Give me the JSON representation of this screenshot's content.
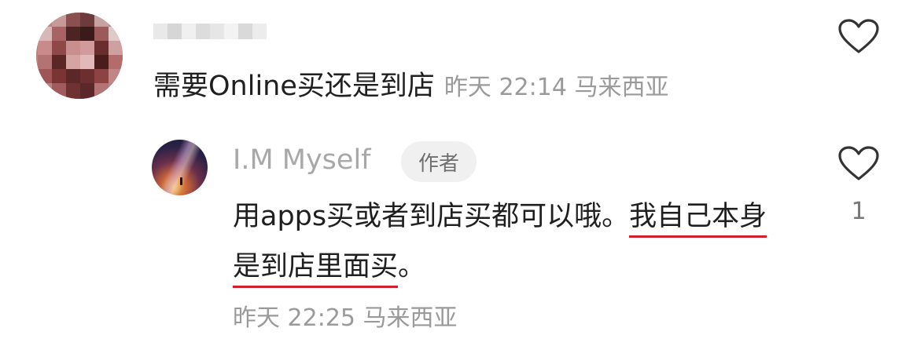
{
  "comment": {
    "text": "需要Online买还是到店",
    "date": "昨天",
    "time": "22:14",
    "location": "马来西亚"
  },
  "reply": {
    "author": "I.M Myself",
    "badge": "作者",
    "text_plain": "用apps买或者到店买都可以哦。",
    "text_highlighted": "我自己本身是到店里面买",
    "text_end": "。",
    "date": "昨天",
    "time": "22:25",
    "location": "马来西亚",
    "likes": "1"
  },
  "icons": {
    "like": "heart-outline-icon"
  },
  "colors": {
    "highlight_underline": "#d21f2b",
    "meta_text": "#9a9a9a"
  }
}
